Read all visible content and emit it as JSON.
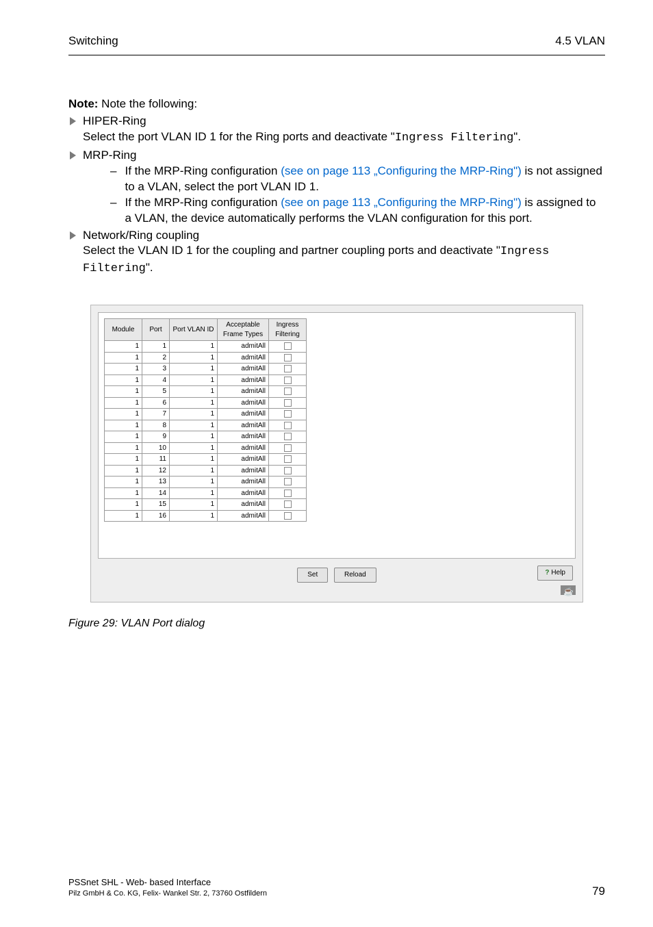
{
  "header": {
    "left": "Switching",
    "right": "4.5 VLAN"
  },
  "note": {
    "label": "Note:",
    "text": " Note the following:"
  },
  "bullets": {
    "b1": {
      "title": "HIPER-Ring",
      "line1a": "Select the port VLAN ID 1 for the Ring ports and deactivate \"",
      "mono1": "Ingress Filtering",
      "line1b": "\"."
    },
    "b2": {
      "title": "MRP-Ring",
      "sub1a": "If the MRP-Ring configuration ",
      "sub1link": "(see on page 113 „Configuring the MRP-Ring\")",
      "sub1b": " is not assigned to a VLAN, select the port VLAN ID 1.",
      "sub2a": "If the MRP-Ring configuration ",
      "sub2link": "(see on page 113 „Configuring the MRP-Ring\")",
      "sub2b": " is assigned to a VLAN, the device automatically performs the VLAN configuration for this port."
    },
    "b3": {
      "title": "Network/Ring coupling",
      "line1": "Select the VLAN ID 1 for the coupling and partner coupling ports and deactivate \"",
      "mono": "Ingress Filtering",
      "line2": "\"."
    }
  },
  "table": {
    "headers": {
      "module": "Module",
      "port": "Port",
      "pvid": "Port VLAN ID",
      "frame": "Acceptable Frame Types",
      "ing": "Ingress Filtering"
    },
    "rows": [
      {
        "module": "1",
        "port": "1",
        "pvid": "1",
        "frame": "admitAll"
      },
      {
        "module": "1",
        "port": "2",
        "pvid": "1",
        "frame": "admitAll"
      },
      {
        "module": "1",
        "port": "3",
        "pvid": "1",
        "frame": "admitAll"
      },
      {
        "module": "1",
        "port": "4",
        "pvid": "1",
        "frame": "admitAll"
      },
      {
        "module": "1",
        "port": "5",
        "pvid": "1",
        "frame": "admitAll"
      },
      {
        "module": "1",
        "port": "6",
        "pvid": "1",
        "frame": "admitAll"
      },
      {
        "module": "1",
        "port": "7",
        "pvid": "1",
        "frame": "admitAll"
      },
      {
        "module": "1",
        "port": "8",
        "pvid": "1",
        "frame": "admitAll"
      },
      {
        "module": "1",
        "port": "9",
        "pvid": "1",
        "frame": "admitAll"
      },
      {
        "module": "1",
        "port": "10",
        "pvid": "1",
        "frame": "admitAll"
      },
      {
        "module": "1",
        "port": "11",
        "pvid": "1",
        "frame": "admitAll"
      },
      {
        "module": "1",
        "port": "12",
        "pvid": "1",
        "frame": "admitAll"
      },
      {
        "module": "1",
        "port": "13",
        "pvid": "1",
        "frame": "admitAll"
      },
      {
        "module": "1",
        "port": "14",
        "pvid": "1",
        "frame": "admitAll"
      },
      {
        "module": "1",
        "port": "15",
        "pvid": "1",
        "frame": "admitAll"
      },
      {
        "module": "1",
        "port": "16",
        "pvid": "1",
        "frame": "admitAll"
      }
    ]
  },
  "buttons": {
    "set": "Set",
    "reload": "Reload",
    "help": "Help"
  },
  "caption": "Figure 29: VLAN Port dialog",
  "footer": {
    "line1": "PSSnet SHL - Web- based Interface",
    "line2": "Pilz GmbH & Co. KG, Felix- Wankel Str. 2, 73760 Ostfildern",
    "page": "79"
  },
  "chart_data": {
    "type": "table",
    "title": "VLAN Port dialog",
    "columns": [
      "Module",
      "Port",
      "Port VLAN ID",
      "Acceptable Frame Types",
      "Ingress Filtering"
    ],
    "rows": [
      [
        1,
        1,
        1,
        "admitAll",
        false
      ],
      [
        1,
        2,
        1,
        "admitAll",
        false
      ],
      [
        1,
        3,
        1,
        "admitAll",
        false
      ],
      [
        1,
        4,
        1,
        "admitAll",
        false
      ],
      [
        1,
        5,
        1,
        "admitAll",
        false
      ],
      [
        1,
        6,
        1,
        "admitAll",
        false
      ],
      [
        1,
        7,
        1,
        "admitAll",
        false
      ],
      [
        1,
        8,
        1,
        "admitAll",
        false
      ],
      [
        1,
        9,
        1,
        "admitAll",
        false
      ],
      [
        1,
        10,
        1,
        "admitAll",
        false
      ],
      [
        1,
        11,
        1,
        "admitAll",
        false
      ],
      [
        1,
        12,
        1,
        "admitAll",
        false
      ],
      [
        1,
        13,
        1,
        "admitAll",
        false
      ],
      [
        1,
        14,
        1,
        "admitAll",
        false
      ],
      [
        1,
        15,
        1,
        "admitAll",
        false
      ],
      [
        1,
        16,
        1,
        "admitAll",
        false
      ]
    ]
  }
}
